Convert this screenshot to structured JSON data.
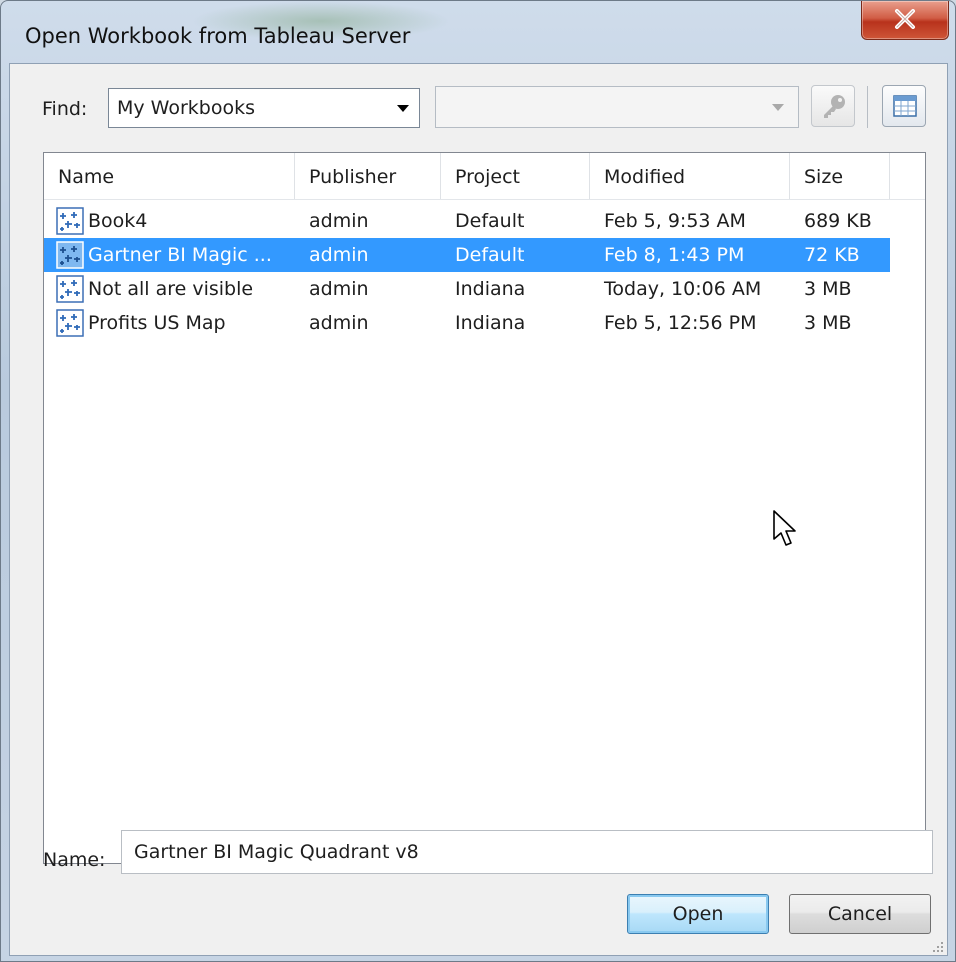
{
  "window": {
    "title": "Open Workbook from Tableau Server"
  },
  "find": {
    "label": "Find:",
    "selected": "My Workbooks",
    "search_value": ""
  },
  "list": {
    "columns": [
      "Name",
      "Publisher",
      "Project",
      "Modified",
      "Size"
    ],
    "rows": [
      {
        "name": "Book4",
        "publisher": "admin",
        "project": "Default",
        "modified": "Feb 5, 9:53 AM",
        "size": "689 KB",
        "selected": false
      },
      {
        "name": "Gartner BI Magic ...",
        "publisher": "admin",
        "project": "Default",
        "modified": "Feb 8, 1:43 PM",
        "size": "72 KB",
        "selected": true
      },
      {
        "name": "Not all are visible",
        "publisher": "admin",
        "project": "Indiana",
        "modified": "Today, 10:06 AM",
        "size": "3 MB",
        "selected": false
      },
      {
        "name": "Profits US Map",
        "publisher": "admin",
        "project": "Indiana",
        "modified": "Feb 5, 12:56 PM",
        "size": "3 MB",
        "selected": false
      }
    ]
  },
  "name_field": {
    "label": "Name:",
    "value": "Gartner BI Magic Quadrant v8"
  },
  "buttons": {
    "open": "Open",
    "cancel": "Cancel"
  },
  "colors": {
    "selection": "#3399ff",
    "close_button": "#c7432b",
    "dialog_bg": "#f0f0f0"
  },
  "icons": [
    "close-icon",
    "key-icon",
    "view-details-icon",
    "workbook-icon",
    "resize-grip-icon",
    "mouse-cursor-icon"
  ]
}
